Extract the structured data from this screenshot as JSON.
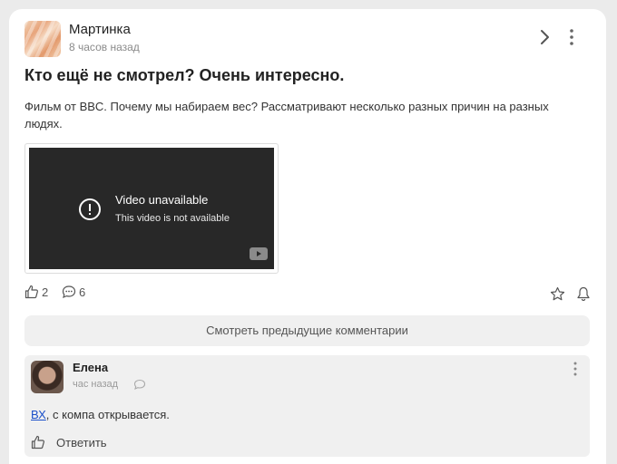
{
  "post": {
    "author": "Мартинка",
    "time": "8 часов назад",
    "title": "Кто ещё не смотрел? Очень интересно.",
    "text": "Фильм от BBC. Почему мы набираем вес? Рассматривают несколько разных причин на разных людях.",
    "video": {
      "title": "Video unavailable",
      "subtitle": "This video is not available"
    },
    "likes": "2",
    "comments": "6"
  },
  "prev_comments_label": "Смотреть предыдущие комментарии",
  "comment": {
    "author": "Елена",
    "time": "час назад",
    "link_text": "ВХ",
    "text": ", с компа открывается.",
    "reply_label": "Ответить"
  },
  "icons": {
    "chevron": "chevron-right-icon",
    "more": "more-vertical-icon",
    "like": "thumbs-up-icon",
    "comment": "comment-icon",
    "star": "star-icon",
    "bell": "bell-icon",
    "error": "alert-circle-icon",
    "youtube": "youtube-icon"
  },
  "colors": {
    "card": "#ffffff",
    "background": "#ebebeb",
    "link": "#1a4fc9",
    "video_bg": "#282828"
  }
}
